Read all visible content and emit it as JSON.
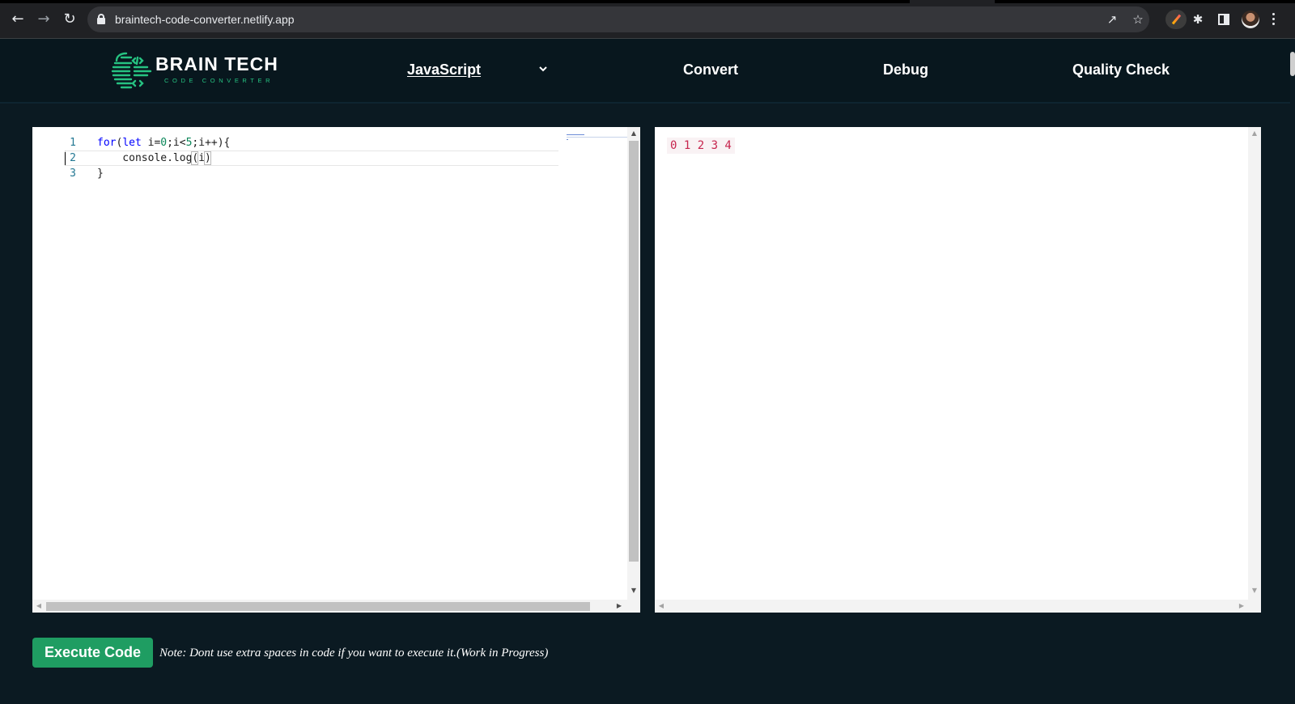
{
  "browser": {
    "url": "braintech-code-converter.netlify.app",
    "icons": {
      "back": "back-arrow-icon",
      "forward": "forward-arrow-icon",
      "reload": "reload-icon",
      "lock": "lock-icon",
      "share": "share-icon",
      "bookmark": "star-icon",
      "extension_pen": "pen-extension-icon",
      "extensions": "puzzle-icon",
      "side_panel": "side-panel-icon",
      "profile": "avatar",
      "menu": "kebab-menu-icon"
    }
  },
  "header": {
    "brand": {
      "name": "BRAIN TECH",
      "tagline": "CODE CONVERTER",
      "accent_color": "#26c281"
    },
    "language_select": {
      "selected": "JavaScript"
    },
    "nav": {
      "convert": "Convert",
      "debug": "Debug",
      "quality_check": "Quality Check"
    }
  },
  "editor": {
    "line_numbers": [
      "1",
      "2",
      "3"
    ],
    "lines": [
      "for(let i=0;i<5;i++){",
      "    console.log(i)",
      "}"
    ]
  },
  "output": {
    "text": "0 1 2 3 4"
  },
  "footer": {
    "execute_label": "Execute Code",
    "note": "Note: Dont use extra spaces in code if you want to execute it.(Work in Progress)",
    "button_color": "#1f9d62"
  }
}
